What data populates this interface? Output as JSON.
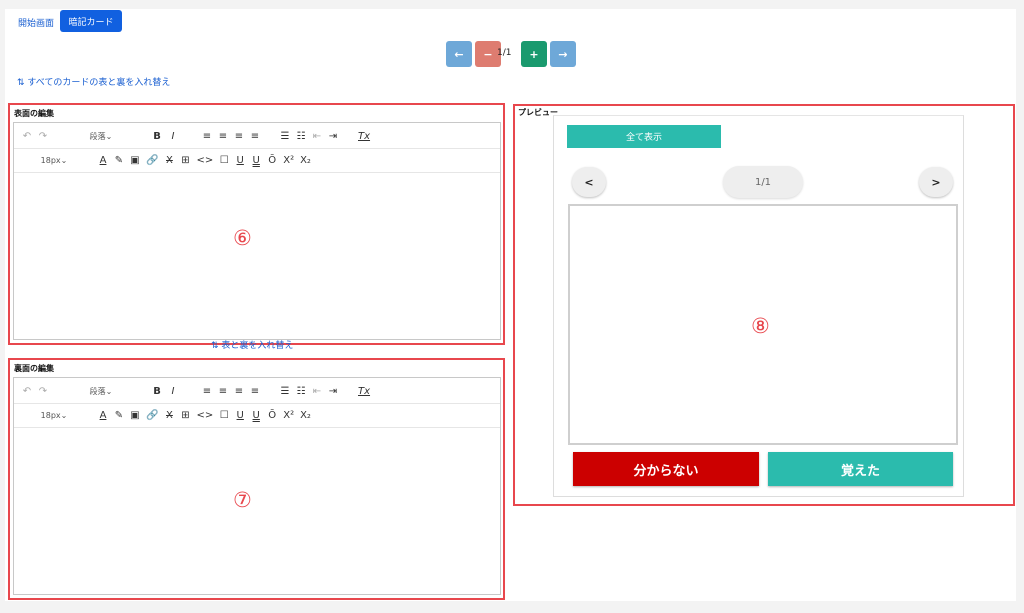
{
  "nav": {
    "home_link": "開始画面",
    "active_tab": "暗記カード"
  },
  "pager": {
    "prev": "←",
    "remove": "−",
    "indicator": "1/1",
    "add": "+",
    "next": "→"
  },
  "swap_all_label": "⇅ すべてのカードの表と裏を入れ替え",
  "swap_label": "⇅ 表と裏を入れ替え",
  "front_editor": {
    "title": "表面の編集",
    "marker": "⑥"
  },
  "back_editor": {
    "title": "裏面の編集",
    "marker": "⑦"
  },
  "toolbar": {
    "undo": "↶",
    "redo": "↷",
    "paragraph": "段落",
    "bold": "B",
    "italic": "I",
    "align_left": "≡",
    "align_center": "≡",
    "align_right": "≡",
    "align_justify": "≡",
    "bullet_list": "☰",
    "numbered_list": "☷",
    "outdent": "⇤",
    "indent": "⇥",
    "clear_format": "Tx",
    "font_size": "18px",
    "font_color": "A",
    "highlight": "✎",
    "image": "▣",
    "link": "🔗",
    "strikethrough": "X",
    "table": "⊞",
    "code": "<>",
    "box": "☐",
    "underline": "U",
    "double_underline": "U",
    "overline": "Ō",
    "superscript": "X²",
    "subscript": "X₂",
    "chev": "⌄"
  },
  "preview": {
    "title": "プレビュー",
    "show_all": "全て表示",
    "prev": "<",
    "counter": "1/1",
    "next": ">",
    "marker": "⑧",
    "dont_know": "分からない",
    "remembered": "覚えた"
  },
  "colors": {
    "primary": "#1160e0",
    "nav_blue": "#6ea8d8",
    "nav_red": "#de7c70",
    "nav_green": "#1a9a6e",
    "teal": "#2bbbad",
    "red": "#cc0000",
    "highlight_border": "#e8474d"
  }
}
